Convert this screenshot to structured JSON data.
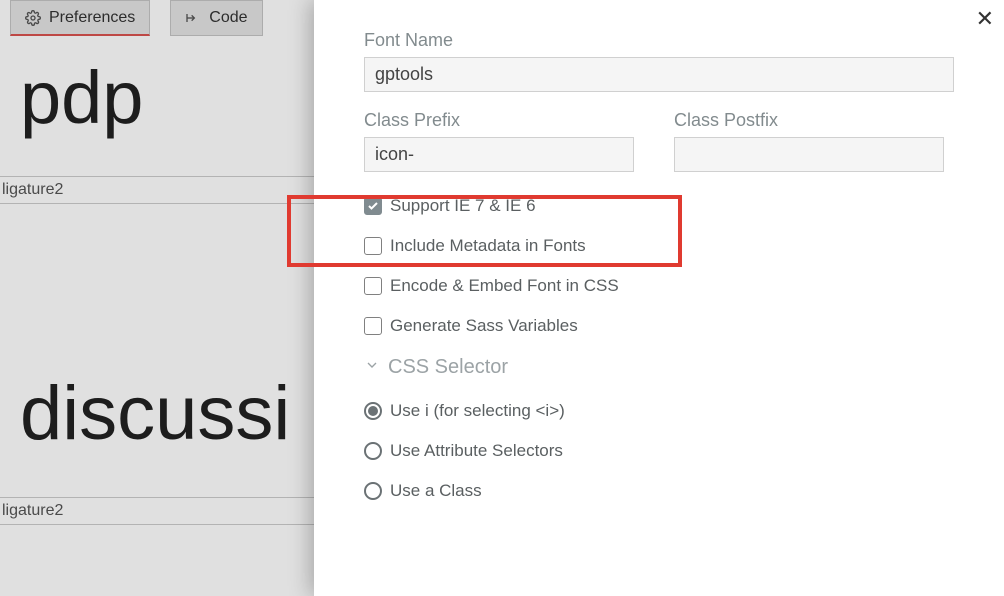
{
  "toolbar": {
    "preferences_label": "Preferences",
    "codes_label": "Code"
  },
  "background": {
    "glyph1": "pdp",
    "glyph2": "discussi",
    "ligature_label": "ligature2"
  },
  "modal": {
    "font_name_label": "Font Name",
    "font_name_value": "gptools",
    "class_prefix_label": "Class Prefix",
    "class_prefix_value": "icon-",
    "class_postfix_label": "Class Postfix",
    "class_postfix_value": "",
    "checks": {
      "support_ie": "Support IE 7 & IE 6",
      "include_metadata": "Include Metadata in Fonts",
      "encode_embed": "Encode & Embed Font in CSS",
      "generate_sass": "Generate Sass Variables"
    },
    "section": "CSS Selector",
    "radios": {
      "use_i": "Use i (for selecting <i>)",
      "use_attr": "Use Attribute Selectors",
      "use_class": "Use a Class"
    }
  }
}
